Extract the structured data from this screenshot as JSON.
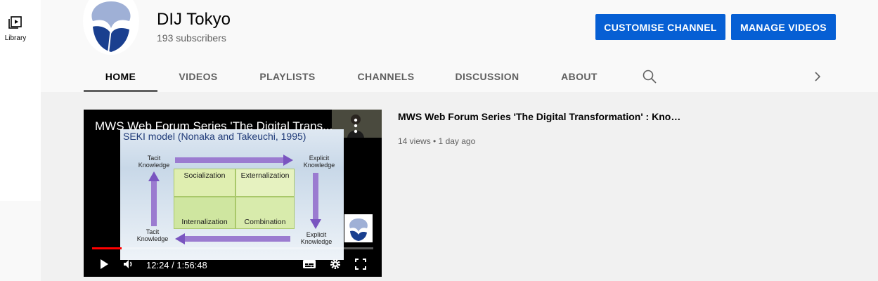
{
  "guide": {
    "library_label": "Library",
    "library_icon": "library-icon"
  },
  "channel": {
    "name": "DIJ Tokyo",
    "subscribers": "193 subscribers",
    "brand_color": "#1a3f8f"
  },
  "actions": {
    "customise_label": "CUSTOMISE CHANNEL",
    "manage_label": "MANAGE VIDEOS",
    "button_color": "#065fd4"
  },
  "tabs": [
    {
      "label": "HOME",
      "active": true
    },
    {
      "label": "VIDEOS",
      "active": false
    },
    {
      "label": "PLAYLISTS",
      "active": false
    },
    {
      "label": "CHANNELS",
      "active": false
    },
    {
      "label": "DISCUSSION",
      "active": false
    },
    {
      "label": "ABOUT",
      "active": false
    }
  ],
  "featured": {
    "player_overlay_title": "MWS Web Forum Series 'The Digital Trans...",
    "title": "MWS Web Forum Series 'The Digital Transformation' : Knowl...",
    "meta": "14 views • 1 day ago",
    "time_display": "12:24 / 1:56:48",
    "progress_fraction": 0.106,
    "slide": {
      "heading": "SEKI model (Nonaka and Takeuchi, 1995)",
      "tacit_top": "Tacit Knowledge",
      "explicit_top": "Explicit Knowledge",
      "tacit_bottom": "Tacit Knowledge",
      "explicit_bottom": "Explicit Knowledge",
      "socialization": "Socialization",
      "externalization": "Externalization",
      "internalization": "Internalization",
      "combination": "Combination"
    }
  }
}
